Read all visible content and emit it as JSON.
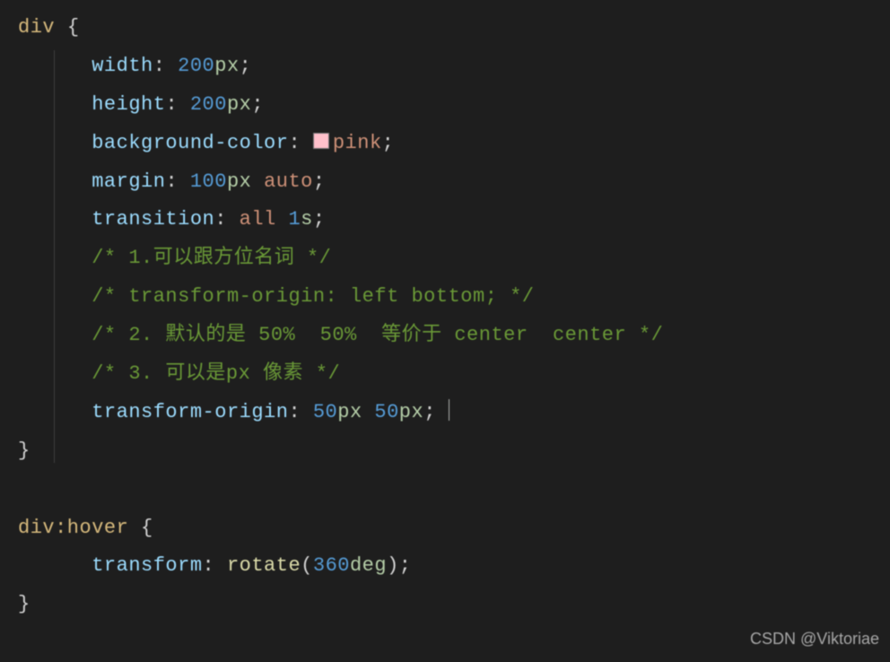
{
  "code": {
    "rule1": {
      "selector": "div",
      "width_prop": "width",
      "width_num": "200",
      "width_unit": "px",
      "height_prop": "height",
      "height_num": "200",
      "height_unit": "px",
      "bg_prop": "background-color",
      "bg_val": "pink",
      "margin_prop": "margin",
      "margin_num": "100",
      "margin_unit": "px",
      "margin_auto": "auto",
      "transition_prop": "transition",
      "transition_all": "all",
      "transition_num": "1",
      "transition_unit": "s",
      "comment1": "/* 1.可以跟方位名词 */",
      "comment2": "/* transform-origin: left bottom; */",
      "comment3": "/* 2. 默认的是 50%  50%  等价于 center  center */",
      "comment4": "/* 3. 可以是px 像素 */",
      "to_prop": "transform-origin",
      "to_num1": "50",
      "to_unit1": "px",
      "to_num2": "50",
      "to_unit2": "px"
    },
    "rule2": {
      "selector": "div",
      "pseudo": ":hover",
      "transform_prop": "transform",
      "rotate_func": "rotate",
      "rotate_num": "360",
      "rotate_unit": "deg"
    }
  },
  "watermark": "CSDN @Viktoriae"
}
